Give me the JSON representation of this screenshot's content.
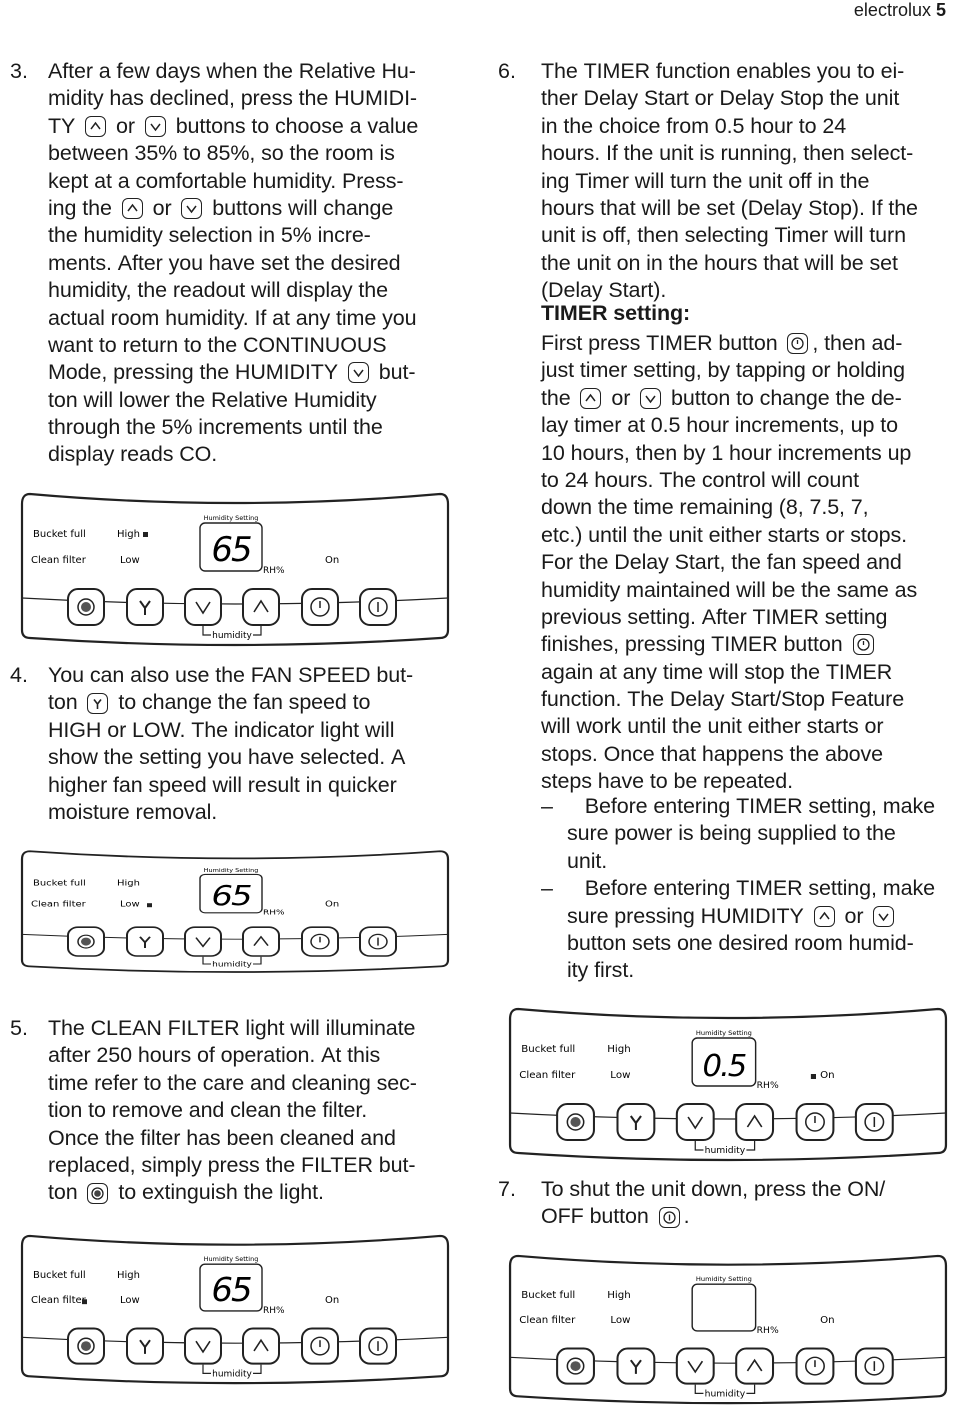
{
  "header": {
    "brand": "electrolux",
    "page": "5"
  },
  "left": {
    "p3": {
      "num": "3.",
      "lines": [
        "After a few days when the Relative Hu-",
        "midity has declined, press the HUMIDI-",
        "TY [up] or [down] buttons to choose a value",
        "between 35% to 85%, so the room is",
        "kept at a comfortable humidity. Press-",
        "ing the [up] or [down] buttons will change",
        "the humidity selection in 5% incre-",
        "ments. After you have set the desired",
        "humidity, the readout will display the",
        "actual room humidity. If at any time you",
        "want to return to the CONTINUOUS",
        "Mode, pressing the HUMIDITY [down] but-",
        "ton will lower the Relative Humidity",
        "through the 5% increments until the",
        "display reads CO."
      ]
    },
    "p4": {
      "num": "4.",
      "lines": [
        "You can also use the FAN SPEED but-",
        "ton [fan] to change the fan speed to",
        "HIGH or LOW. The indicator light will",
        "show the setting you have selected. A",
        "higher fan speed will result in quicker",
        "moisture removal."
      ]
    },
    "p5": {
      "num": "5.",
      "lines": [
        "The CLEAN FILTER light will illuminate",
        "after 250 hours of operation. At this",
        "time refer to the care and cleaning sec-",
        "tion to remove and clean the filter.",
        "Once the filter has been cleaned and",
        "replaced, simply press the FILTER but-",
        "ton [filter] to extinguish the light."
      ]
    }
  },
  "right": {
    "p6": {
      "num": "6.",
      "lines": [
        "The TIMER function enables you to ei-",
        "ther Delay Start or Delay Stop the unit",
        "in the choice from 0.5 hour to 24",
        "hours. If the unit is running, then select-",
        "ing Timer will turn the unit off in the",
        "hours that will be set (Delay Stop). If the",
        "unit is off, then selecting Timer will turn",
        "the unit on in the hours that will be set",
        "(Delay Start)."
      ]
    },
    "timer_heading": "TIMER setting:",
    "timer_text": {
      "lines": [
        "First press TIMER button [timer], then ad-",
        "just timer setting, by tapping or holding",
        "the [up] or [down] button to change the de-",
        "lay timer at 0.5 hour increments, up to",
        "10 hours, then by 1 hour increments up",
        "to 24 hours. The control will count",
        "down the time remaining (8, 7.5, 7,",
        "etc.) until the unit either starts or stops.",
        "For the Delay Start, the fan speed and",
        "humidity maintained will be the same as",
        "previous setting. After TIMER setting",
        "finishes, pressing TIMER button [timer]",
        "again at any time will stop the TIMER",
        "function. The Delay Start/Stop Feature",
        "will work until the unit either starts or",
        "stops. Once that happens the above",
        "steps have to be repeated."
      ]
    },
    "bullets": {
      "lines": [
        "– [tab]Before entering TIMER setting, make",
        "[tab]sure power is being supplied to the",
        "[tab]unit.",
        "– [tab]Before entering TIMER setting, make",
        "[tab]sure pressing HUMIDITY [up] or [down]",
        "[tab]button sets one desired room humid-",
        "[tab]ity first."
      ]
    },
    "p7": {
      "num": "7.",
      "lines": [
        "To shut the unit down, press the ON/",
        "OFF button [power]."
      ]
    }
  },
  "panel_labels": {
    "bucket_full": "Bucket full",
    "clean_filter": "Clean filter",
    "high": "High",
    "low": "Low",
    "humidity_setting": "Humidity Setting",
    "rh": "RH%",
    "on": "On",
    "humidity": "humidity"
  },
  "panels": [
    {
      "display": "65",
      "indicator": "high"
    },
    {
      "display": "65",
      "indicator": "low"
    },
    {
      "display": "65",
      "indicator": "clean_filter"
    },
    {
      "display": "0.5",
      "indicator": "on"
    },
    {
      "display": "",
      "indicator": "none"
    }
  ]
}
